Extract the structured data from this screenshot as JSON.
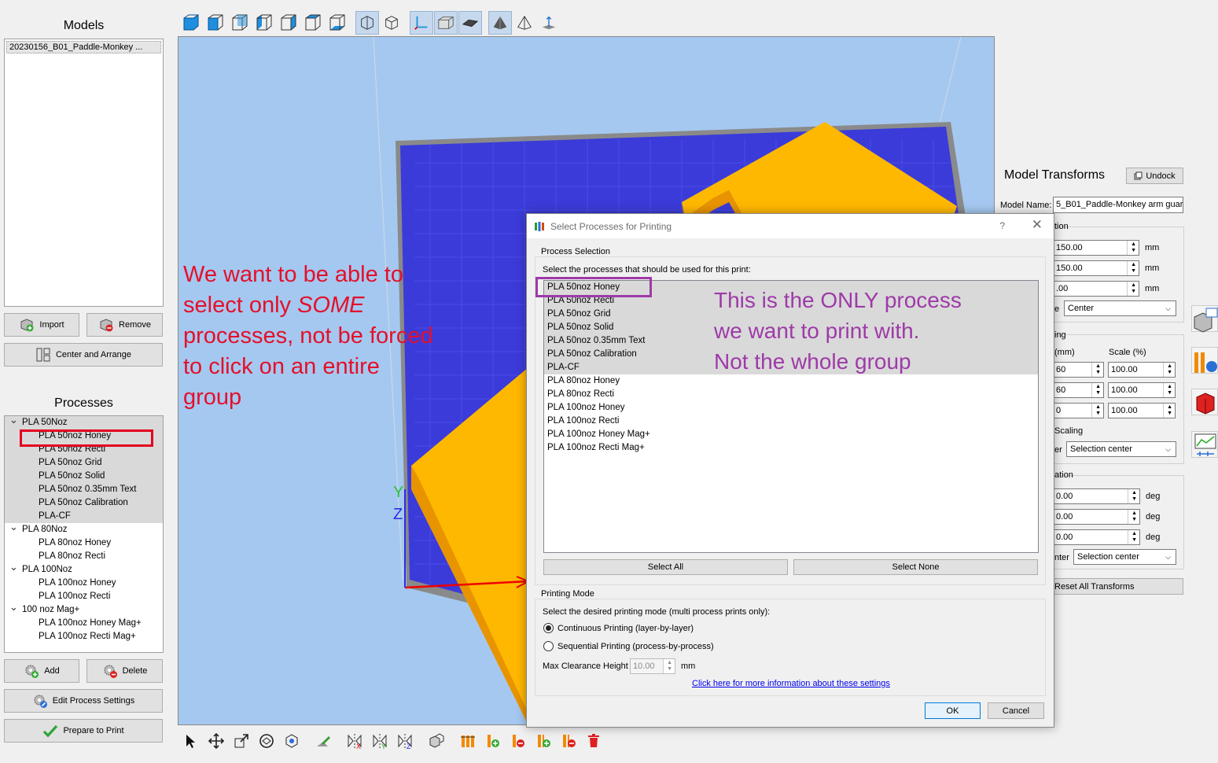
{
  "models": {
    "title": "Models",
    "items": [
      "20230156_B01_Paddle-Monkey ..."
    ],
    "import_label": "Import",
    "remove_label": "Remove",
    "center_arrange_label": "Center and Arrange"
  },
  "processes": {
    "title": "Processes",
    "tree": [
      {
        "label": "PLA 50Noz",
        "children": [
          "PLA 50noz Honey",
          "PLA 50noz Recti",
          "PLA 50noz Grid",
          "PLA 50noz Solid",
          "PLA 50noz 0.35mm Text",
          "PLA 50noz Calibration",
          "PLA-CF"
        ]
      },
      {
        "label": "PLA 80Noz",
        "children": [
          "PLA 80noz Honey",
          "PLA 80noz Recti"
        ]
      },
      {
        "label": "PLA 100Noz",
        "children": [
          "PLA 100noz Honey",
          "PLA 100noz Recti"
        ]
      },
      {
        "label": "100 noz Mag+",
        "children": [
          "PLA 100noz Honey Mag+",
          "PLA 100noz Recti Mag+"
        ]
      }
    ],
    "add_label": "Add",
    "delete_label": "Delete",
    "edit_label": "Edit Process Settings",
    "prepare_label": "Prepare to Print"
  },
  "annotations": {
    "red_text": [
      "We want to be able to",
      "select only ",
      "SOME",
      "processes, not be forced",
      "to click on an entire",
      "group"
    ],
    "purple_text": [
      "This is the ONLY process",
      "we want to print with.",
      "Not the whole group"
    ]
  },
  "transforms": {
    "title": "Model Transforms",
    "undock_label": "Undock",
    "model_name_label": "Model Name:",
    "model_name_value": "5_B01_Paddle-Monkey arm guard",
    "position_label": "tion",
    "position_values": [
      "150.00",
      "150.00",
      ".00"
    ],
    "unit_mm": "mm",
    "place_label": "e",
    "place_value": "Center",
    "sizing_label": "ing",
    "size_header": "(mm)",
    "scale_header": "Scale (%)",
    "size_values": [
      "60",
      "60",
      "0"
    ],
    "scale_values": [
      "100.00",
      "100.00",
      "100.00"
    ],
    "scaling_label": "Scaling",
    "scale_about_label": "er",
    "scale_about_value": "Selection center",
    "rotation_label": "ation",
    "rotation_values": [
      "0.00",
      "0.00",
      "0.00"
    ],
    "unit_deg": "deg",
    "rotate_about_label": "nter",
    "rotate_about_value": "Selection center",
    "reset_label": "Reset All Transforms"
  },
  "dialog": {
    "title": "Select Processes for Printing",
    "help": "?",
    "close": "✕",
    "process_selection_label": "Process Selection",
    "instruction": "Select the processes that should be used for this print:",
    "items": [
      "PLA 50noz Honey",
      "PLA 50noz Recti",
      "PLA 50noz Grid",
      "PLA 50noz Solid",
      "PLA 50noz 0.35mm Text",
      "PLA 50noz Calibration",
      "PLA-CF",
      "PLA 80noz Honey",
      "PLA 80noz Recti",
      "PLA 100noz Honey",
      "PLA 100noz Recti",
      "PLA 100noz Honey Mag+",
      "PLA 100noz Recti Mag+"
    ],
    "select_all_label": "Select All",
    "select_none_label": "Select None",
    "printing_mode_label": "Printing Mode",
    "mode_instruction": "Select the desired printing mode (multi process prints only):",
    "continuous_label": "Continuous Printing (layer-by-layer)",
    "sequential_label": "Sequential Printing (process-by-process)",
    "clearance_label": "Max Clearance Height",
    "clearance_value": "10.00",
    "clearance_unit": "mm",
    "info_link": "Click here for more information about these settings",
    "ok_label": "OK",
    "cancel_label": "Cancel"
  },
  "colors": {
    "bed": "#3b3bd9",
    "model": "#ffb800",
    "sky": "#a5c8f0",
    "annotation_red": "#e4102a",
    "annotation_purple": "#9e3aa8"
  }
}
